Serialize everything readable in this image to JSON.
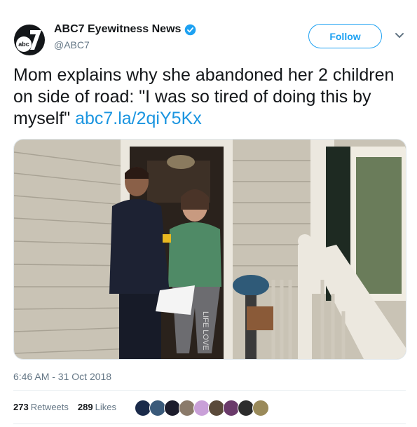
{
  "author": {
    "display_name": "ABC7 Eyewitness News",
    "handle": "@ABC7",
    "avatar_text": "abc",
    "brand_color": "#1e64c8",
    "verified_color": "#1da1f2"
  },
  "follow_label": "Follow",
  "tweet": {
    "text": "Mom explains why she abandoned her 2 children on side of road: \"I was so tired of doing this by myself\"",
    "link": "abc7.la/2qiY5Kx"
  },
  "media": {
    "shirt_text": "LIFE LOVE"
  },
  "timestamp": "6:46 AM - 31 Oct 2018",
  "stats": {
    "retweets_count": "273",
    "retweets_label": "Retweets",
    "likes_count": "289",
    "likes_label": "Likes"
  },
  "likers": [
    {
      "color": "#1a2a4a"
    },
    {
      "color": "#3a5a7a"
    },
    {
      "color": "#1c1c2c"
    },
    {
      "color": "#8a7a6a"
    },
    {
      "color": "#c9a0d8"
    },
    {
      "color": "#5a4a3a"
    },
    {
      "color": "#6a3a6a"
    },
    {
      "color": "#2c2c2c"
    },
    {
      "color": "#9a8a5a"
    }
  ]
}
